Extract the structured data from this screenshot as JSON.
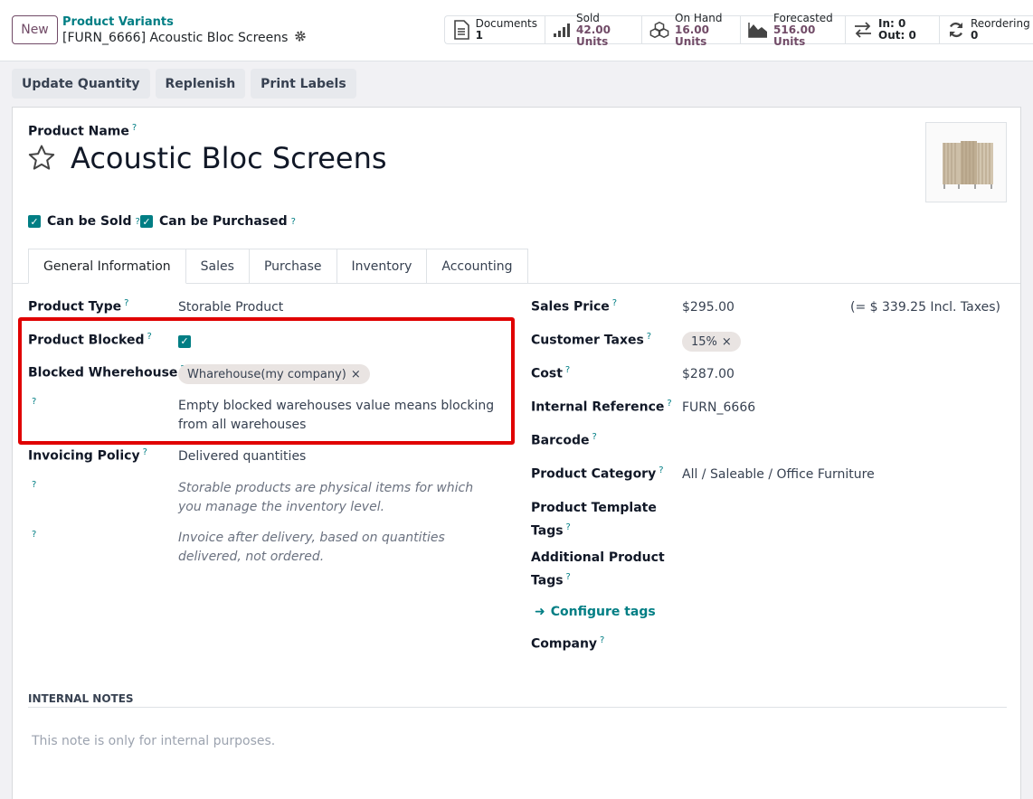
{
  "header": {
    "new_label": "New",
    "breadcrumb_parent": "Product Variants",
    "breadcrumb_current": "[FURN_6666] Acoustic Bloc Screens"
  },
  "smart_buttons": [
    {
      "title": "Documents",
      "value": "1",
      "icon": "document-icon"
    },
    {
      "title": "Sold",
      "value": "42.00 Units",
      "icon": "bar-chart-icon"
    },
    {
      "title": "On Hand",
      "value": "16.00 Units",
      "icon": "cubes-icon"
    },
    {
      "title": "Forecasted",
      "value": "516.00 Units",
      "icon": "area-chart-icon"
    },
    {
      "title": "In: 0",
      "value": "Out: 0",
      "icon": "exchange-icon"
    },
    {
      "title": "Reordering R",
      "value": "0",
      "icon": "refresh-icon"
    }
  ],
  "actions": {
    "update_quantity": "Update Quantity",
    "replenish": "Replenish",
    "print_labels": "Print Labels"
  },
  "product": {
    "name_label": "Product Name",
    "name": "Acoustic Bloc Screens",
    "can_be_sold": "Can be Sold",
    "can_be_purchased": "Can be Purchased"
  },
  "tabs": [
    "General Information",
    "Sales",
    "Purchase",
    "Inventory",
    "Accounting"
  ],
  "left": {
    "product_type_label": "Product Type",
    "product_type": "Storable Product",
    "product_blocked_label": "Product Blocked",
    "blocked_warehouse_label": "Blocked Wherehouse",
    "blocked_warehouse_tag": "Wharehouse(my company)",
    "blocked_help": "Empty blocked warehouses value means blocking from all warehouses",
    "invoicing_policy_label": "Invoicing Policy",
    "invoicing_policy": "Delivered quantities",
    "help_storable": "Storable products are physical items for which you manage the inventory level.",
    "help_invoice": "Invoice after delivery, based on quantities delivered, not ordered."
  },
  "right": {
    "sales_price_label": "Sales Price",
    "sales_price": "$295.00",
    "incl_taxes": "(= $ 339.25 Incl. Taxes)",
    "customer_taxes_label": "Customer Taxes",
    "customer_taxes_tag": "15%",
    "cost_label": "Cost",
    "cost": "$287.00",
    "internal_ref_label": "Internal Reference",
    "internal_ref": "FURN_6666",
    "barcode_label": "Barcode",
    "category_label": "Product Category",
    "category": "All / Saleable / Office Furniture",
    "template_tags_label_1": "Product Template",
    "template_tags_label_2": "Tags",
    "additional_tags_label_1": "Additional Product",
    "additional_tags_label_2": "Tags",
    "configure_tags": "Configure tags",
    "company_label": "Company"
  },
  "notes": {
    "title": "INTERNAL NOTES",
    "placeholder": "This note is only for internal purposes."
  },
  "colors": {
    "accent_teal": "#017e84",
    "brand_purple": "#714b67",
    "highlight_red": "#e00000"
  }
}
